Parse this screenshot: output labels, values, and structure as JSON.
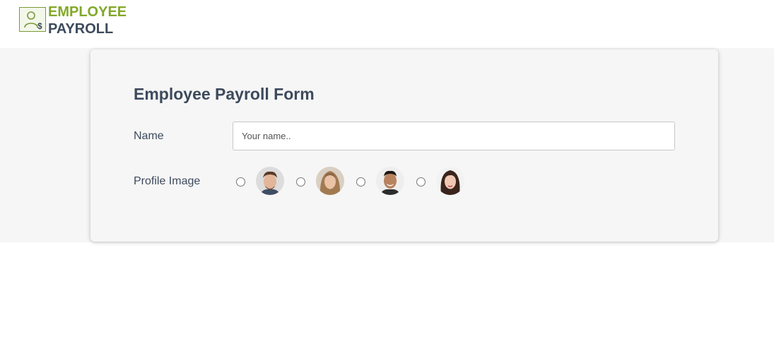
{
  "header": {
    "logo_line1": "EMPLOYEE",
    "logo_line2": "PAYROLL",
    "logo_icon": "employee-dollar-icon",
    "colors": {
      "accent_green": "#82a82a",
      "dark_text": "#3d4a5c"
    }
  },
  "form": {
    "title": "Employee Payroll Form",
    "name_label": "Name",
    "name_placeholder": "Your name..",
    "name_value": "",
    "profile_label": "Profile Image",
    "profile_options": [
      {
        "avatar": "man-1-avatar",
        "selected": false
      },
      {
        "avatar": "woman-1-avatar",
        "selected": false
      },
      {
        "avatar": "man-2-avatar",
        "selected": false
      },
      {
        "avatar": "woman-2-avatar",
        "selected": false
      }
    ]
  }
}
